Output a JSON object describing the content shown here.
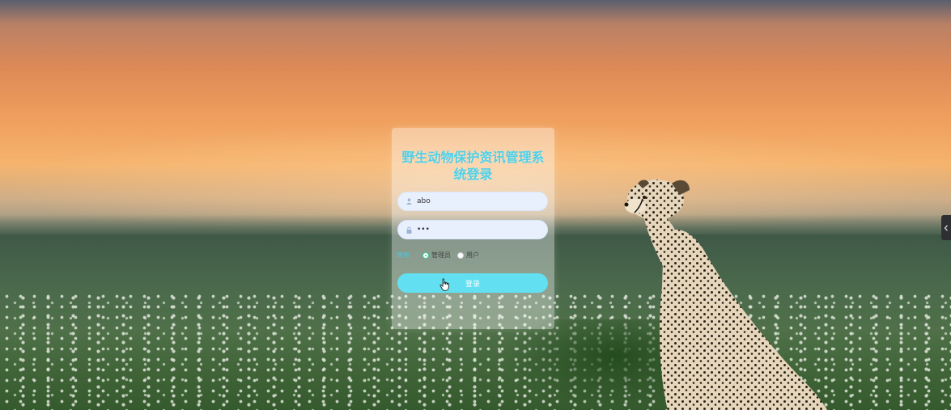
{
  "login": {
    "title": "野生动物保护资讯管理系统登录",
    "username_value": "abo",
    "password_value": "abc",
    "role_label": "角色",
    "roles": [
      {
        "label": "管理员",
        "checked": true
      },
      {
        "label": "用户",
        "checked": false
      }
    ],
    "submit_label": "登录"
  },
  "icons": {
    "username": "user-icon",
    "password": "lock-icon",
    "side_tab": "chevron-left-icon",
    "pointer": "hand-pointer-icon"
  },
  "colors": {
    "accent": "#62e0f1",
    "title": "#4fd0e8",
    "radio_checked": "#2bc48a"
  }
}
